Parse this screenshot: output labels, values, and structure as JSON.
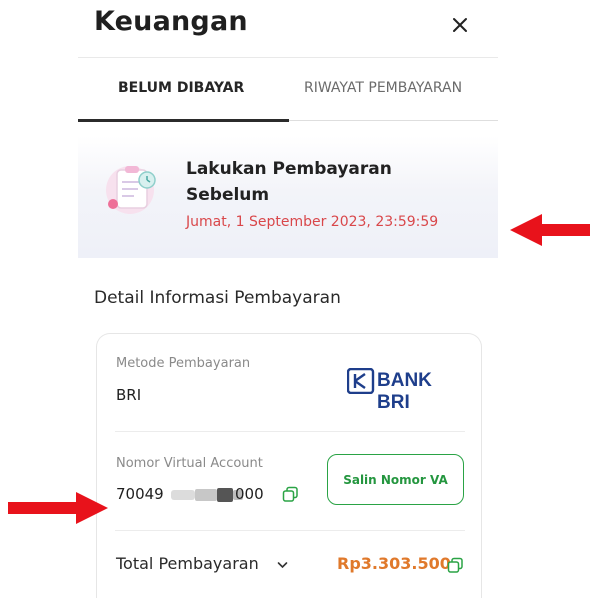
{
  "header": {
    "title": "Keuangan",
    "close_icon": "close-icon"
  },
  "tabs": [
    {
      "label": "BELUM DIBAYAR",
      "active": true
    },
    {
      "label": "RIWAYAT PEMBAYARAN",
      "active": false
    }
  ],
  "deadline": {
    "title_line1": "Lakukan Pembayaran",
    "title_line2": "Sebelum",
    "date": "Jumat, 1 September 2023, 23:59:59",
    "illustration_icon": "clipboard-clock-icon"
  },
  "detail": {
    "section_title": "Detail Informasi Pembayaran",
    "method_label": "Metode Pembayaran",
    "method_value": "BRI",
    "bank_logo_text": "BANK BRI",
    "va_label": "Nomor Virtual Account",
    "va_visible_prefix": "70049",
    "va_visible_suffix": "000",
    "copy_button_label": "Salin Nomor VA",
    "total_label": "Total Pembayaran",
    "total_amount": "Rp3.303.500"
  },
  "colors": {
    "accent_green": "#2aa345",
    "deadline_red": "#d9474a",
    "amount_orange": "#e0792b",
    "bri_blue": "#1e3e8b",
    "annotation_arrow": "#e8121b"
  },
  "icons": [
    "close-icon",
    "copy-icon",
    "chevron-down-icon",
    "annotation-arrow-icon"
  ]
}
